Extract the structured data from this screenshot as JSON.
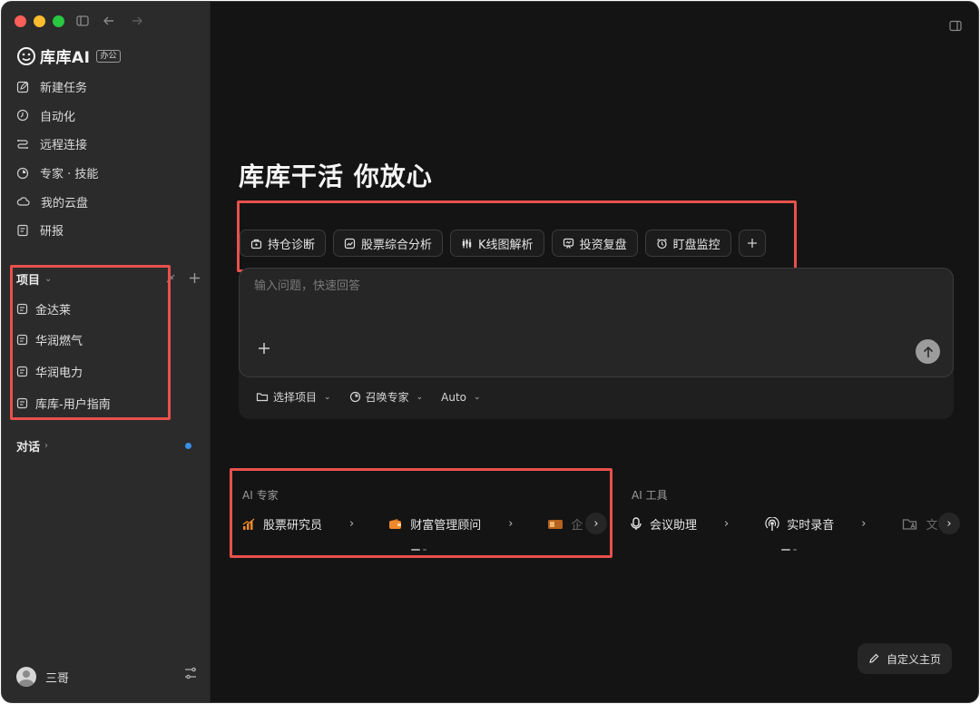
{
  "app": {
    "name": "库库AI",
    "badge": "办公"
  },
  "sidebar": {
    "nav": [
      {
        "label": "新建任务",
        "icon": "edit-icon"
      },
      {
        "label": "自动化",
        "icon": "clock-icon"
      },
      {
        "label": "远程连接",
        "icon": "remote-icon"
      },
      {
        "label": "专家 · 技能",
        "icon": "expert-icon"
      },
      {
        "label": "我的云盘",
        "icon": "cloud-icon"
      },
      {
        "label": "研报",
        "icon": "report-icon"
      }
    ],
    "projects_title": "项目",
    "projects": [
      {
        "label": "金达莱"
      },
      {
        "label": "华润燃气"
      },
      {
        "label": "华润电力"
      },
      {
        "label": "库库-用户指南"
      }
    ],
    "chats_title": "对话",
    "user_name": "三哥"
  },
  "main": {
    "hero_title": "库库干活 你放心",
    "chips": [
      {
        "label": "持仓诊断",
        "icon": "portfolio-icon"
      },
      {
        "label": "股票综合分析",
        "icon": "chart-icon"
      },
      {
        "label": "K线图解析",
        "icon": "candlestick-icon"
      },
      {
        "label": "投资复盘",
        "icon": "review-icon"
      },
      {
        "label": "盯盘监控",
        "icon": "alarm-icon"
      }
    ],
    "composer": {
      "placeholder": "输入问题，快速回答",
      "options": [
        {
          "label": "选择项目"
        },
        {
          "label": "召唤专家"
        },
        {
          "label": "Auto"
        }
      ]
    },
    "ai_experts": {
      "title": "AI 专家",
      "items": [
        {
          "label": "股票研究员"
        },
        {
          "label": "财富管理顾问"
        },
        {
          "label": "企"
        }
      ]
    },
    "ai_tools": {
      "title": "AI 工具",
      "items": [
        {
          "label": "会议助理"
        },
        {
          "label": "实时录音"
        },
        {
          "label": "文"
        }
      ]
    },
    "customize_label": "自定义主页"
  },
  "colors": {
    "highlight": "#e9504c",
    "accent_orange": "#f0892b",
    "dot_blue": "#3a8ee6"
  }
}
